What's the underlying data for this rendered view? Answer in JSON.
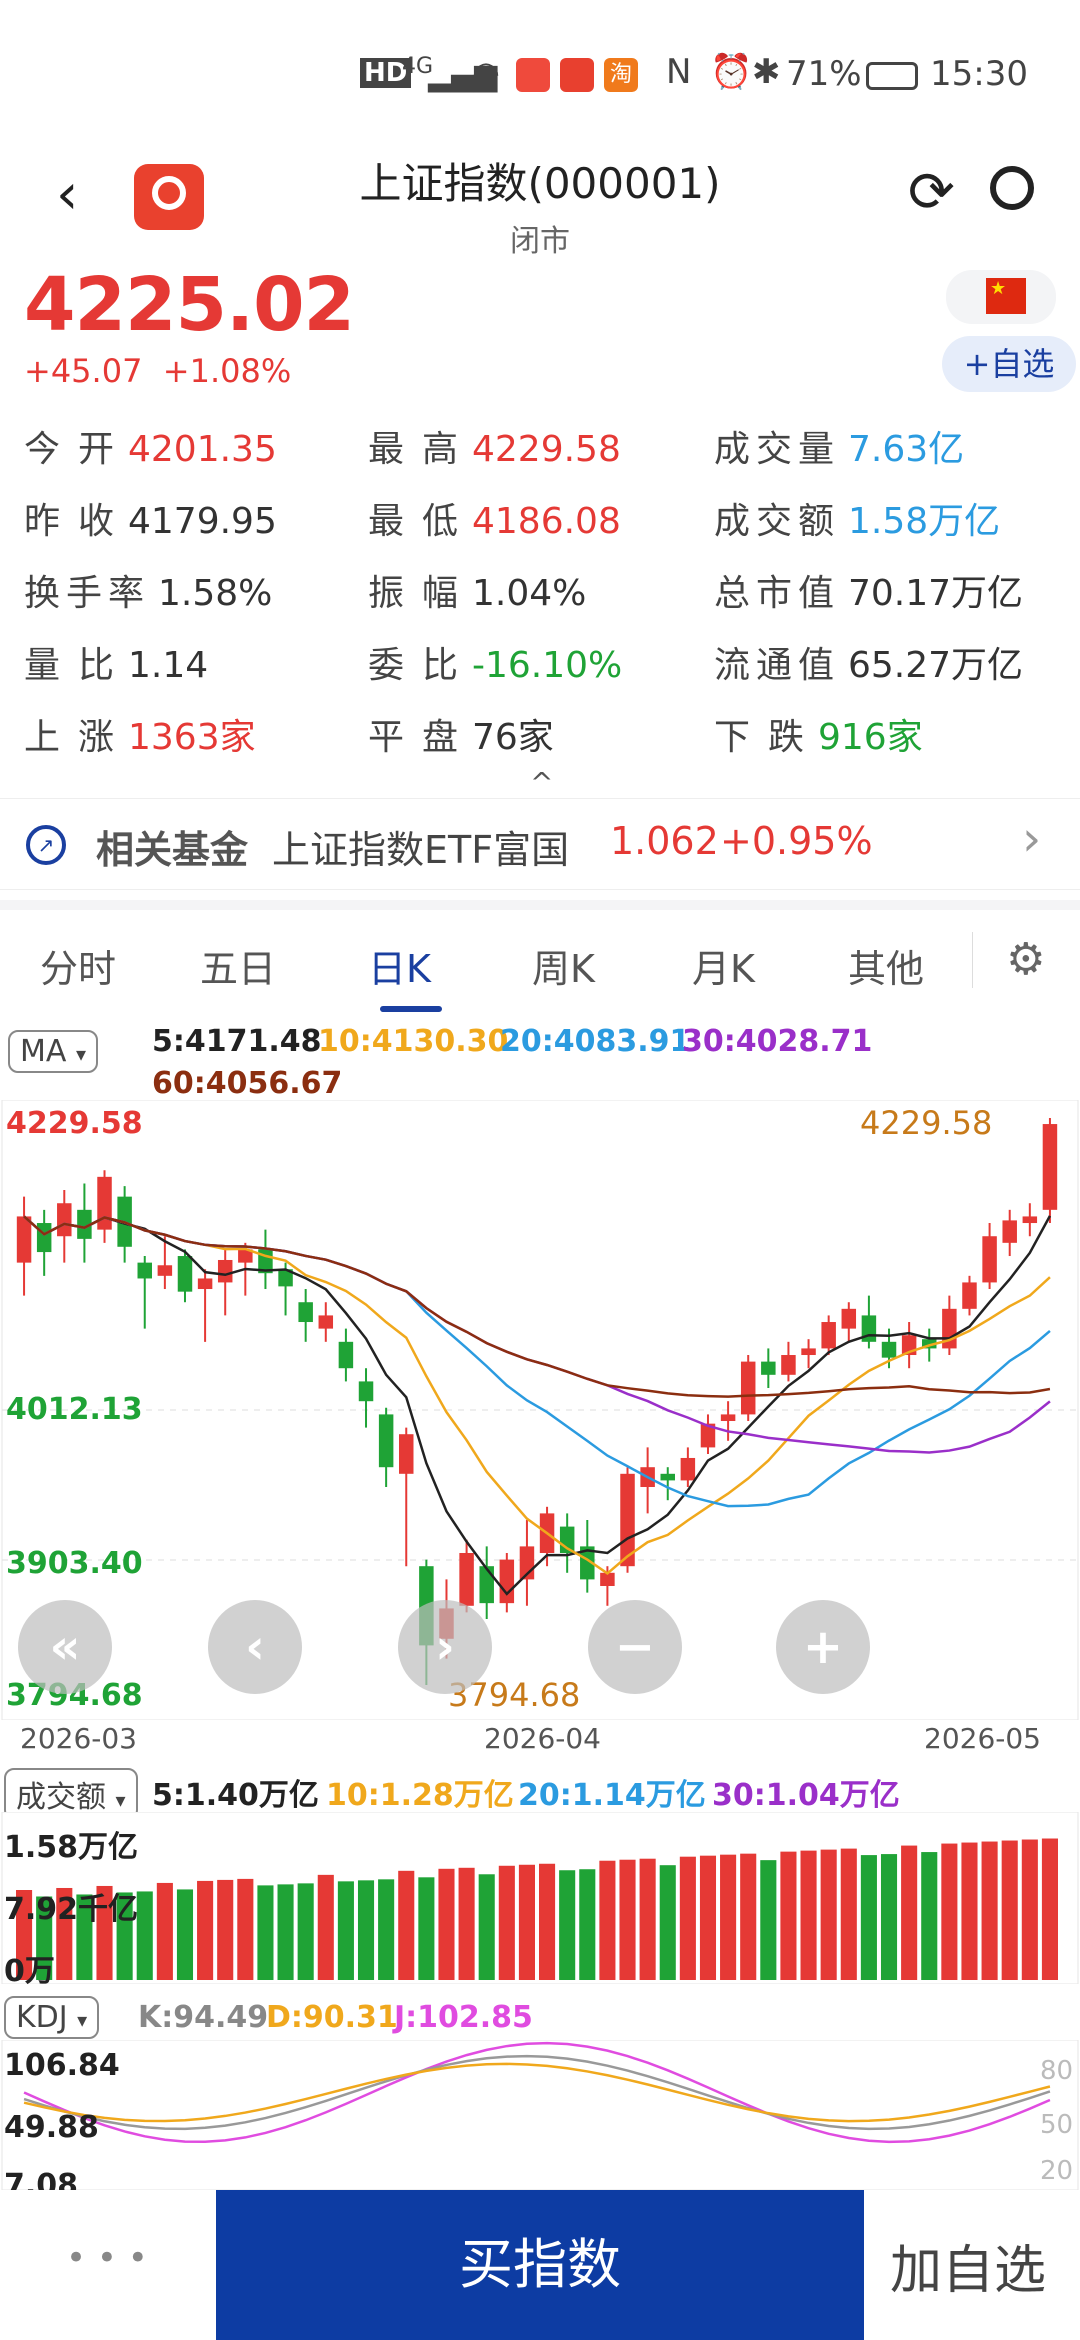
{
  "status_bar": {
    "battery": "71%",
    "time": "15:30",
    "network": "4G"
  },
  "header": {
    "title": "上证指数(000001)",
    "subtitle": "闭市"
  },
  "quote": {
    "price": "4225.02",
    "change": "+45.07",
    "change_pct": "+1.08%",
    "add_watch": "+自选"
  },
  "stats": [
    [
      {
        "label": "今开",
        "value": "4201.35",
        "color": "red"
      },
      {
        "label": "最高",
        "value": "4229.58",
        "color": "red"
      },
      {
        "label": "成交量",
        "value": "7.63亿",
        "color": "blue"
      }
    ],
    [
      {
        "label": "昨收",
        "value": "4179.95",
        "color": "dark"
      },
      {
        "label": "最低",
        "value": "4186.08",
        "color": "red"
      },
      {
        "label": "成交额",
        "value": "1.58万亿",
        "color": "blue"
      }
    ],
    [
      {
        "label": "换手率",
        "value": "1.58%",
        "color": "dark"
      },
      {
        "label": "振幅",
        "value": "1.04%",
        "color": "dark"
      },
      {
        "label": "总市值",
        "value": "70.17万亿",
        "color": "dark"
      }
    ],
    [
      {
        "label": "量比",
        "value": "1.14",
        "color": "dark"
      },
      {
        "label": "委比",
        "value": "-16.10%",
        "color": "green"
      },
      {
        "label": "流通值",
        "value": "65.27万亿",
        "color": "dark"
      }
    ],
    [
      {
        "label": "上涨",
        "value": "1363家",
        "color": "red"
      },
      {
        "label": "平盘",
        "value": "76家",
        "color": "dark"
      },
      {
        "label": "下跌",
        "value": "916家",
        "color": "green"
      }
    ]
  ],
  "fund": {
    "title": "相关基金",
    "name": "上证指数ETF富国",
    "price": "1.062",
    "change": "+0.95%"
  },
  "tabs": [
    "分时",
    "五日",
    "日K",
    "周K",
    "月K",
    "其他"
  ],
  "active_tab": "日K",
  "ma": {
    "selector": "MA",
    "ma5": "5:4171.48",
    "ma10": "10:4130.30",
    "ma20": "20:4083.91",
    "ma30": "30:4028.71",
    "ma60": "60:4056.67"
  },
  "price_axis": {
    "top": "4229.58",
    "mid1": "4012.13",
    "mid2": "3903.40",
    "bottom": "3794.68",
    "max_label": "4229.58",
    "min_label": "3794.68"
  },
  "dates": [
    "2026-03",
    "2026-04",
    "2026-05"
  ],
  "volume": {
    "selector": "成交额",
    "ma5": "5:1.40万亿",
    "ma10": "10:1.28万亿",
    "ma20": "20:1.14万亿",
    "ma30": "30:1.04万亿",
    "ax_top": "1.58万亿",
    "ax_mid": "7.92千亿",
    "ax_bottom": "0万"
  },
  "kdj": {
    "selector": "KDJ",
    "k": "K:94.49",
    "d": "D:90.31",
    "j": "J:102.85",
    "ax_top": "106.84",
    "ax_mid": "49.88",
    "ax_bottom": "7.08",
    "right_ticks": [
      "80",
      "50",
      "20"
    ]
  },
  "bottom_bar": {
    "more": "• • •",
    "buy": "买指数",
    "watch": "加自选"
  },
  "colors": {
    "up": "#e53935",
    "down": "#1fa336",
    "ma5": "#222222",
    "ma10": "#f0a81c",
    "ma20": "#2b9be0",
    "ma30": "#9a2fc9",
    "ma60": "#8b2e10",
    "accent": "#0d3ca3"
  },
  "chart_data": {
    "type": "candlestick",
    "x_labels": [
      "2026-03",
      "2026-04",
      "2026-05"
    ],
    "ylim": [
      3794.68,
      4229.58
    ],
    "candles": [
      [
        4120,
        4155,
        4095,
        4170
      ],
      [
        4150,
        4128,
        4110,
        4160
      ],
      [
        4140,
        4165,
        4120,
        4175
      ],
      [
        4160,
        4138,
        4120,
        4180
      ],
      [
        4145,
        4185,
        4135,
        4190
      ],
      [
        4170,
        4132,
        4120,
        4178
      ],
      [
        4120,
        4108,
        4070,
        4125
      ],
      [
        4110,
        4118,
        4100,
        4140
      ],
      [
        4125,
        4098,
        4090,
        4130
      ],
      [
        4100,
        4108,
        4060,
        4115
      ],
      [
        4105,
        4122,
        4080,
        4130
      ],
      [
        4120,
        4130,
        4095,
        4135
      ],
      [
        4130,
        4112,
        4100,
        4145
      ],
      [
        4115,
        4102,
        4080,
        4120
      ],
      [
        4090,
        4075,
        4060,
        4100
      ],
      [
        4070,
        4080,
        4060,
        4090
      ],
      [
        4060,
        4040,
        4030,
        4070
      ],
      [
        4030,
        4015,
        3995,
        4040
      ],
      [
        4005,
        3965,
        3950,
        4010
      ],
      [
        3960,
        3990,
        3890,
        3995
      ],
      [
        3890,
        3830,
        3800,
        3895
      ],
      [
        3835,
        3858,
        3820,
        3880
      ],
      [
        3860,
        3900,
        3855,
        3910
      ],
      [
        3890,
        3862,
        3850,
        3905
      ],
      [
        3862,
        3895,
        3855,
        3900
      ],
      [
        3880,
        3905,
        3860,
        3925
      ],
      [
        3900,
        3930,
        3890,
        3935
      ],
      [
        3920,
        3900,
        3885,
        3930
      ],
      [
        3905,
        3880,
        3870,
        3925
      ],
      [
        3875,
        3885,
        3860,
        3890
      ],
      [
        3890,
        3960,
        3885,
        3965
      ],
      [
        3950,
        3965,
        3930,
        3980
      ],
      [
        3960,
        3955,
        3940,
        3965
      ],
      [
        3955,
        3972,
        3950,
        3980
      ],
      [
        3980,
        3998,
        3975,
        4005
      ],
      [
        4000,
        4005,
        3985,
        4015
      ],
      [
        4005,
        4045,
        4000,
        4050
      ],
      [
        4045,
        4035,
        4025,
        4055
      ],
      [
        4035,
        4050,
        4030,
        4060
      ],
      [
        4050,
        4055,
        4040,
        4062
      ],
      [
        4055,
        4075,
        4050,
        4080
      ],
      [
        4070,
        4085,
        4060,
        4090
      ],
      [
        4080,
        4060,
        4055,
        4095
      ],
      [
        4060,
        4048,
        4040,
        4070
      ],
      [
        4050,
        4065,
        4040,
        4075
      ],
      [
        4062,
        4055,
        4045,
        4070
      ],
      [
        4055,
        4085,
        4050,
        4095
      ],
      [
        4085,
        4105,
        4080,
        4110
      ],
      [
        4105,
        4140,
        4100,
        4150
      ],
      [
        4135,
        4152,
        4125,
        4160
      ],
      [
        4150,
        4155,
        4140,
        4165
      ],
      [
        4160,
        4225,
        4150,
        4229.58
      ]
    ]
  }
}
